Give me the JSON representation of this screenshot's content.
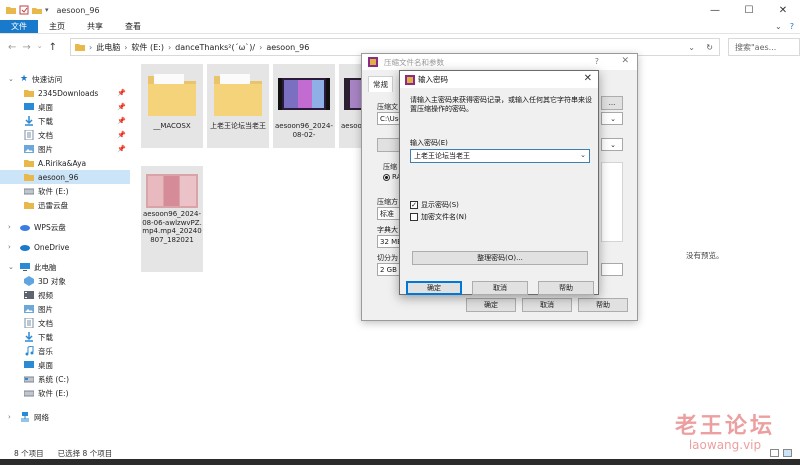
{
  "window": {
    "title": "aesoon_96",
    "ribbon_tabs": [
      "文件",
      "主页",
      "共享",
      "查看"
    ],
    "address": [
      "此电脑",
      "软件 (E:)",
      "danceThanks²(´ω`)/",
      "aesoon_96"
    ],
    "search_placeholder": "搜索\"aes...",
    "minimize": "—",
    "maximize": "☐",
    "close": "✕"
  },
  "nav": {
    "quick_access": "快速访问",
    "items": [
      {
        "label": "2345Downloads",
        "pinned": true
      },
      {
        "label": "桌面",
        "pinned": true
      },
      {
        "label": "下载",
        "pinned": true
      },
      {
        "label": "文档",
        "pinned": true
      },
      {
        "label": "图片",
        "pinned": true
      },
      {
        "label": "A.Ririka&Aya",
        "pinned": false
      },
      {
        "label": "aesoon_96",
        "pinned": false
      },
      {
        "label": "软件 (E:)",
        "pinned": false
      },
      {
        "label": "迅雷云盘",
        "pinned": false
      }
    ],
    "wps": "WPS云盘",
    "onedrive": "OneDrive",
    "this_pc": "此电脑",
    "pc_items": [
      "3D 对象",
      "视频",
      "图片",
      "文档",
      "下载",
      "音乐",
      "桌面",
      "系统 (C:)",
      "软件 (E:)"
    ],
    "network": "网络"
  },
  "files": [
    {
      "name": "__MACOSX",
      "type": "folder"
    },
    {
      "name": "上老王论坛当老王",
      "type": "folder"
    },
    {
      "name": "aesoon96_2024-08-02-",
      "type": "video"
    },
    {
      "name": "aesoon96_2024-08-",
      "type": "video"
    },
    {
      "name": "aesoon96_2024-08-06-awlzwvPZ.mp4.mp4_20240807_182021",
      "type": "image"
    }
  ],
  "preview_text": "没有预览。",
  "status": {
    "count": "8 个项目",
    "selected": "已选择 8 个项目"
  },
  "archive_dialog": {
    "title": "压缩文件名和参数",
    "help": "?",
    "close": "✕",
    "tab_general": "常规",
    "label_archive": "压缩文",
    "path_value": "C:\\Use",
    "label_format": "压缩",
    "radio_rar": "RA",
    "label_method": "压缩方",
    "method_value": "标准",
    "label_dict": "字典大",
    "dict_value": "32 MB",
    "label_split": "切分为",
    "split_value": "2 GB",
    "ok": "确定",
    "cancel": "取消",
    "help_btn": "帮助"
  },
  "password_dialog": {
    "title": "输入密码",
    "close": "✕",
    "description": "请输入主密码来获得密码记录，或输入任何其它字符串来设置压缩操作的密码。",
    "label": "输入密码(E)",
    "value": "上老王论坛当老王",
    "show_password": "显示密码(S)",
    "show_password_checked": true,
    "encrypt_names": "加密文件名(N)",
    "encrypt_names_checked": false,
    "organize": "整理密码(O)...",
    "ok": "确定",
    "cancel": "取消",
    "help": "帮助"
  },
  "watermark": {
    "cn": "老王论坛",
    "url": "laowang.vip"
  }
}
